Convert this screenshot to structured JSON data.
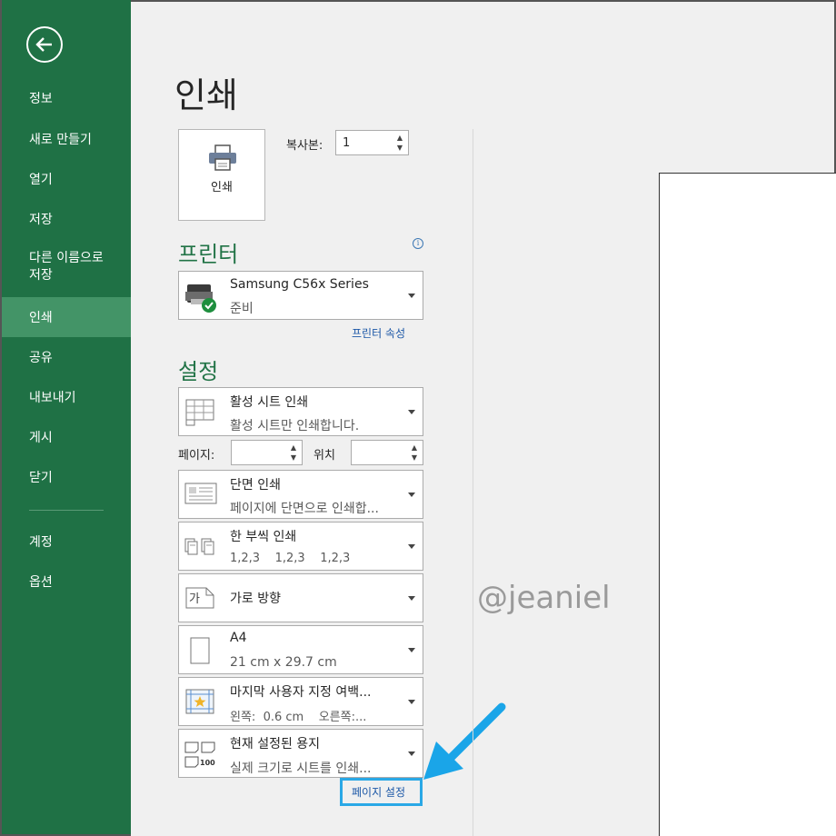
{
  "sidebar": {
    "back_icon": "back-arrow-icon",
    "items": [
      {
        "label": "정보"
      },
      {
        "label": "새로 만들기"
      },
      {
        "label": "열기"
      },
      {
        "label": "저장"
      },
      {
        "label": "다른 이름으로 저장",
        "line1": "다른 이름으로",
        "line2": "저장"
      },
      {
        "label": "인쇄",
        "active": true
      },
      {
        "label": "공유"
      },
      {
        "label": "내보내기"
      },
      {
        "label": "게시"
      },
      {
        "label": "닫기"
      },
      {
        "label": "계정"
      },
      {
        "label": "옵션"
      }
    ]
  },
  "main": {
    "title": "인쇄",
    "print_button": {
      "label": "인쇄",
      "icon": "printer-icon"
    },
    "copies": {
      "label": "복사본:",
      "value": "1"
    }
  },
  "printer": {
    "heading": "프린터",
    "name": "Samsung C56x Series",
    "status": "준비",
    "properties_link": "프린터 속성"
  },
  "settings": {
    "heading": "설정",
    "what": {
      "title": "활성 시트 인쇄",
      "sub": "활성 시트만 인쇄합니다."
    },
    "pages_label": "페이지:",
    "pages_value": "",
    "where_label": "위치",
    "where_value": "",
    "sides": {
      "title": "단면 인쇄",
      "sub": "페이지에 단면으로 인쇄합..."
    },
    "collate": {
      "title": "한 부씩 인쇄",
      "sub": "1,2,3    1,2,3    1,2,3"
    },
    "orientation": {
      "title": "가로 방향",
      "icon_text": "가"
    },
    "paper": {
      "title": "A4",
      "sub": "21 cm x 29.7 cm"
    },
    "margins": {
      "title": "마지막 사용자 지정 여백...",
      "sub": "왼쪽:  0.6 cm    오른쪽:..."
    },
    "scaling": {
      "title": "현재 설정된 용지",
      "sub": "실제 크기로 시트를 인쇄...",
      "icon_text": "100"
    },
    "page_setup_link": "페이지 설정"
  },
  "watermark": "@jeaniel",
  "colors": {
    "sidebar": "#1f7145",
    "sidebar_active": "#439467",
    "heading_green": "#217346",
    "link_blue": "#1a56a6",
    "annotation_blue": "#2aa8e6"
  }
}
